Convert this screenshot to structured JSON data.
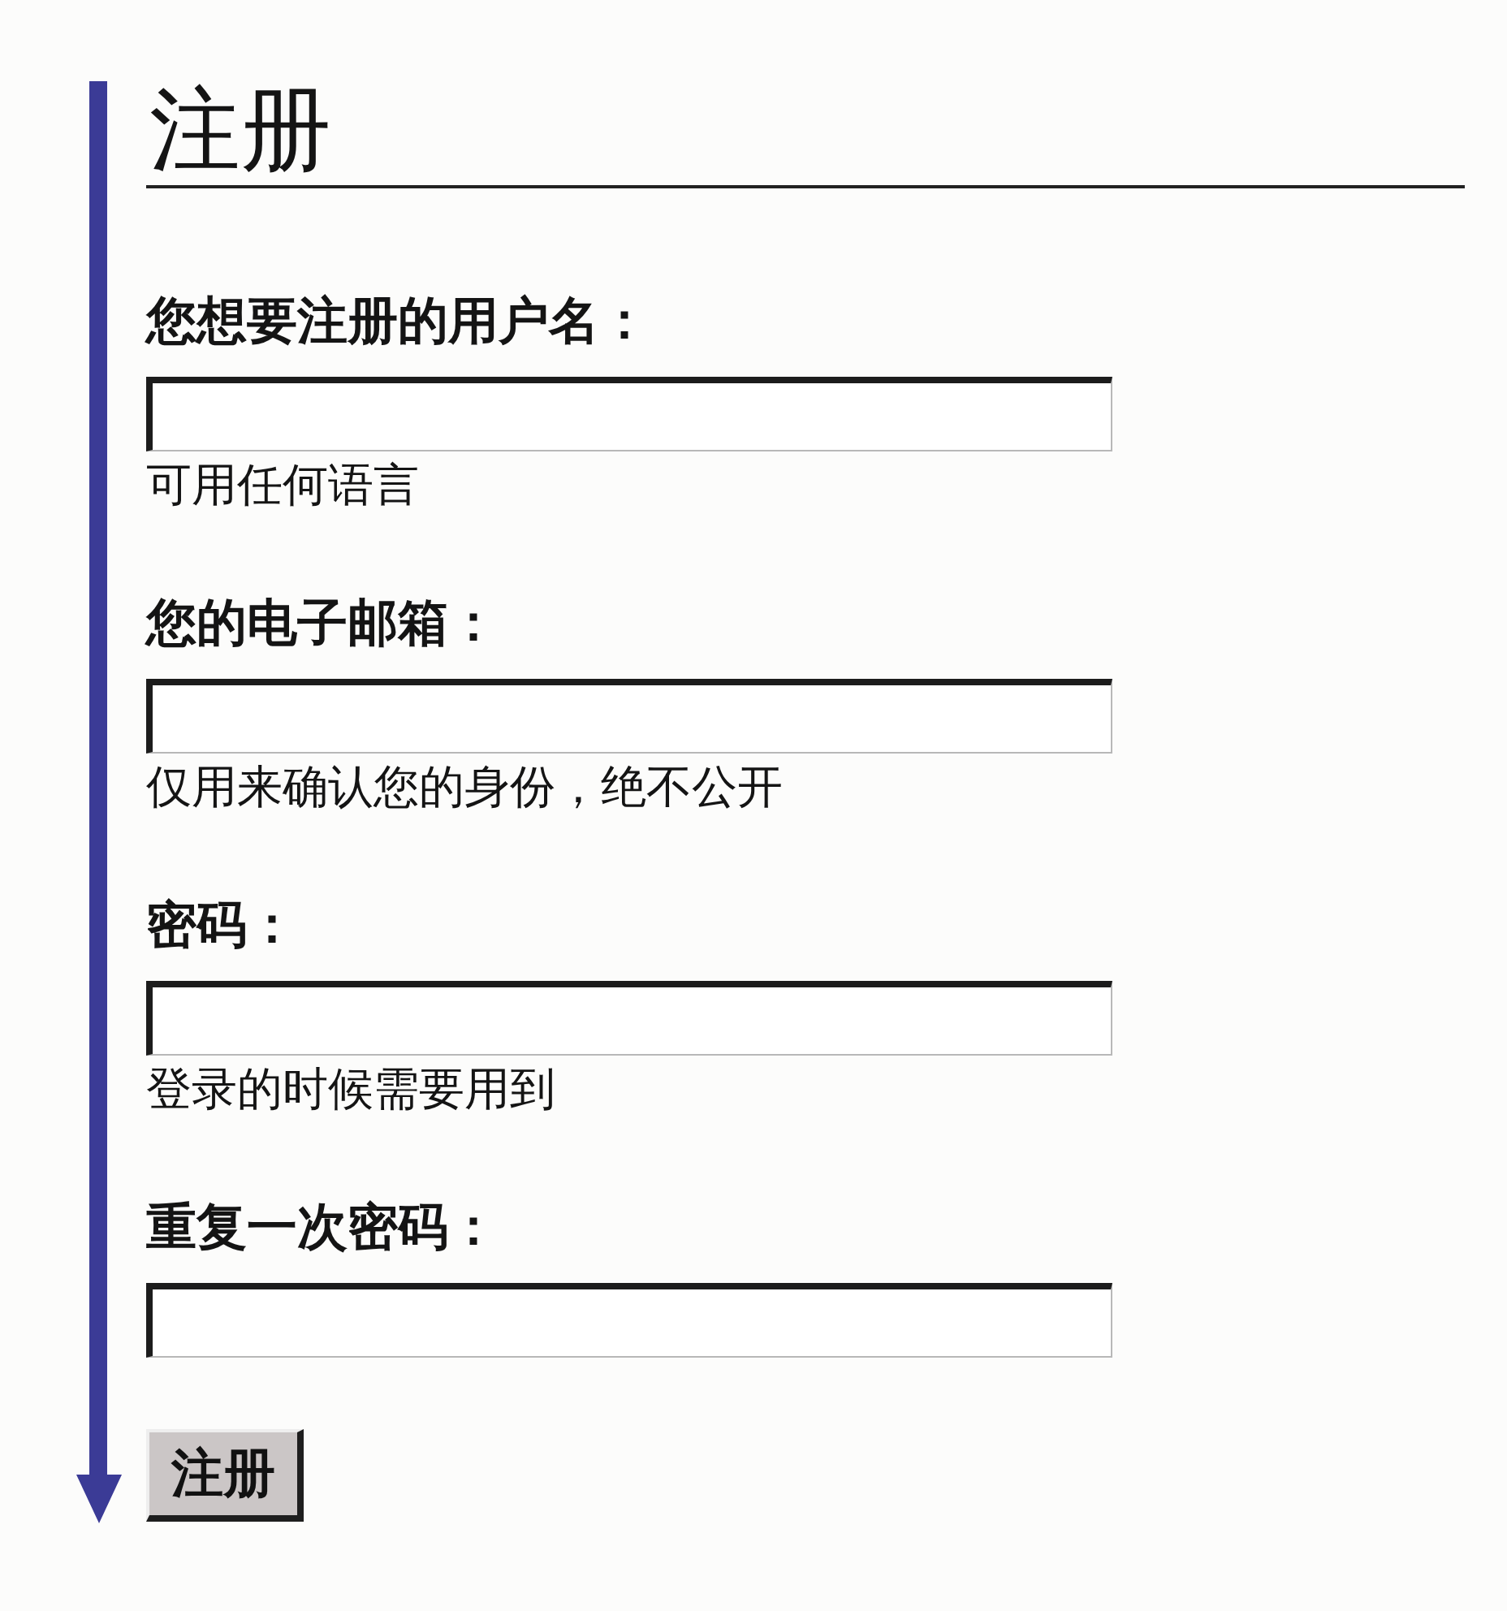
{
  "title": "注册",
  "fields": [
    {
      "label": "您想要注册的用户名：",
      "hint": "可用任何语言"
    },
    {
      "label": "您的电子邮箱：",
      "hint": "仅用来确认您的身份，绝不公开"
    },
    {
      "label": "密码：",
      "hint": "登录的时候需要用到"
    },
    {
      "label": "重复一次密码："
    }
  ],
  "submit_button": {
    "label": "注册"
  }
}
